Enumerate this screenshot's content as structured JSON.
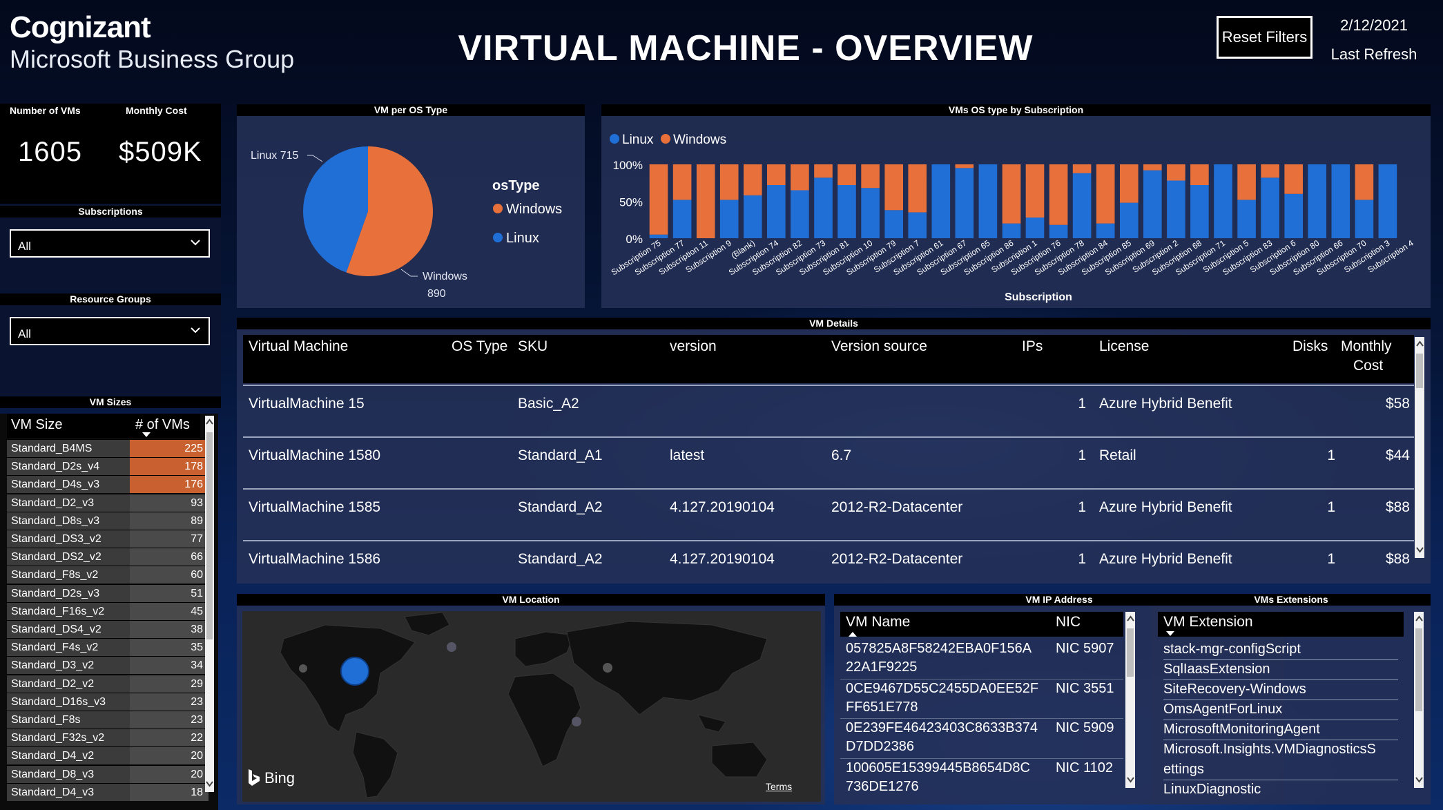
{
  "brand": {
    "company": "Cognizant",
    "group": "Microsoft Business Group"
  },
  "header": {
    "title": "VIRTUAL MACHINE - OVERVIEW",
    "reset_label": "Reset Filters",
    "refresh_date": "2/12/2021",
    "refresh_label": "Last Refresh"
  },
  "kpis": {
    "vms_label": "Number of VMs",
    "vms_value": "1605",
    "cost_label": "Monthly Cost",
    "cost_value": "$509K"
  },
  "filters": {
    "subscriptions_label": "Subscriptions",
    "subscriptions_value": "All",
    "rg_label": "Resource Groups",
    "rg_value": "All"
  },
  "vm_sizes": {
    "title": "VM Sizes",
    "col_size": "VM Size",
    "col_count": "# of VMs",
    "rows": [
      {
        "name": "Standard_B4MS",
        "count": "225",
        "hl": true
      },
      {
        "name": "Standard_D2s_v4",
        "count": "178",
        "hl": true
      },
      {
        "name": "Standard_D4s_v3",
        "count": "176",
        "hl": true
      },
      {
        "name": "Standard_D2_v3",
        "count": "93",
        "hl": false
      },
      {
        "name": "Standard_D8s_v3",
        "count": "89",
        "hl": false
      },
      {
        "name": "Standard_DS3_v2",
        "count": "77",
        "hl": false
      },
      {
        "name": "Standard_DS2_v2",
        "count": "66",
        "hl": false
      },
      {
        "name": "Standard_F8s_v2",
        "count": "60",
        "hl": false
      },
      {
        "name": "Standard_D2s_v3",
        "count": "51",
        "hl": false
      },
      {
        "name": "Standard_F16s_v2",
        "count": "45",
        "hl": false
      },
      {
        "name": "Standard_DS4_v2",
        "count": "38",
        "hl": false
      },
      {
        "name": "Standard_F4s_v2",
        "count": "35",
        "hl": false
      },
      {
        "name": "Standard_D3_v2",
        "count": "34",
        "hl": false
      },
      {
        "name": "Standard_D2_v2",
        "count": "29",
        "hl": false
      },
      {
        "name": "Standard_D16s_v3",
        "count": "23",
        "hl": false
      },
      {
        "name": "Standard_F8s",
        "count": "23",
        "hl": false
      },
      {
        "name": "Standard_F32s_v2",
        "count": "22",
        "hl": false
      },
      {
        "name": "Standard_D4_v2",
        "count": "20",
        "hl": false
      },
      {
        "name": "Standard_D8_v3",
        "count": "20",
        "hl": false
      },
      {
        "name": "Standard_D4_v3",
        "count": "18",
        "hl": false
      }
    ]
  },
  "colors": {
    "linux": "#1f6fd6",
    "windows": "#e8703a",
    "accent_row": "#c8612f"
  },
  "chart_data": [
    {
      "type": "pie",
      "title": "VM per OS Type",
      "legend_title": "osType",
      "labels": [
        "Windows",
        "Linux"
      ],
      "values": [
        890,
        715
      ],
      "slice_labels": [
        "Windows",
        "890",
        "Linux 715"
      ],
      "legend": "right"
    },
    {
      "type": "bar",
      "stacked": "100%",
      "title": "VMs OS type by Subscription",
      "xlabel": "Subscription",
      "y_ticks": [
        "100%",
        "50%",
        "0%"
      ],
      "ylim": [
        0,
        100
      ],
      "legend": "top-left",
      "categories": [
        "Subscription 75",
        "Subscription 77",
        "Subscription 11",
        "Subscription 9",
        "(Blank)",
        "Subscription 74",
        "Subscription 82",
        "Subscription 73",
        "Subscription 81",
        "Subscription 10",
        "Subscription 79",
        "Subscription 7",
        "Subscription 61",
        "Subscription 67",
        "Subscription 65",
        "Subscription 86",
        "Subscription 1",
        "Subscription 76",
        "Subscription 78",
        "Subscription 84",
        "Subscription 85",
        "Subscription 69",
        "Subscription 2",
        "Subscription 68",
        "Subscription 71",
        "Subscription 5",
        "Subscription 83",
        "Subscription 6",
        "Subscription 80",
        "Subscription 66",
        "Subscription 70",
        "Subscription 3",
        "Subscription 4"
      ],
      "series": [
        {
          "name": "Linux",
          "values": [
            5,
            52,
            0,
            52,
            58,
            72,
            65,
            82,
            72,
            68,
            38,
            35,
            100,
            95,
            100,
            20,
            28,
            18,
            88,
            20,
            48,
            92,
            78,
            72,
            100,
            52,
            82,
            60,
            100,
            100,
            52,
            100,
            0
          ]
        },
        {
          "name": "Windows",
          "values": [
            95,
            48,
            100,
            48,
            42,
            28,
            35,
            18,
            28,
            32,
            62,
            65,
            0,
            5,
            0,
            80,
            72,
            82,
            12,
            80,
            52,
            8,
            22,
            28,
            0,
            48,
            18,
            40,
            0,
            0,
            48,
            0,
            0
          ]
        }
      ]
    }
  ],
  "vm_details": {
    "title": "VM Details",
    "columns": [
      "Virtual Machine",
      "OS Type",
      "SKU",
      "version",
      "Version source",
      "IPs",
      "License",
      "Disks",
      "Monthly",
      "Cost"
    ],
    "rows": [
      {
        "vm": "VirtualMachine 15",
        "os": "",
        "sku": "Basic_A2",
        "version": "",
        "source": "",
        "ips": "1",
        "license": "Azure Hybrid Benefit",
        "disks": "",
        "cost": "$58"
      },
      {
        "vm": "VirtualMachine 1580",
        "os": "",
        "sku": "Standard_A1",
        "version": "latest",
        "source": "6.7",
        "ips": "1",
        "license": "Retail",
        "disks": "1",
        "cost": "$44"
      },
      {
        "vm": "VirtualMachine 1585",
        "os": "",
        "sku": "Standard_A2",
        "version": "4.127.20190104",
        "source": "2012-R2-Datacenter",
        "ips": "1",
        "license": "Azure Hybrid Benefit",
        "disks": "1",
        "cost": "$88"
      },
      {
        "vm": "VirtualMachine 1586",
        "os": "",
        "sku": "Standard_A2",
        "version": "4.127.20190104",
        "source": "2012-R2-Datacenter",
        "ips": "1",
        "license": "Azure Hybrid Benefit",
        "disks": "1",
        "cost": "$88"
      }
    ]
  },
  "vm_location": {
    "title": "VM Location",
    "map_logo": "Bing",
    "terms": "Terms"
  },
  "vm_ip": {
    "title": "VM IP Address",
    "col_name": "VM Name",
    "col_nic": "NIC",
    "rows": [
      {
        "l1": "057825A8F58242EBA0F156A",
        "l2": "22A1F9225",
        "nic": "NIC 5907"
      },
      {
        "l1": "0CE9467D55C2455DA0EE52F",
        "l2": "FF651E778",
        "nic": "NIC 3551"
      },
      {
        "l1": "0E239FE46423403C8633B374",
        "l2": "D7DD2386",
        "nic": "NIC 5909"
      },
      {
        "l1": "100605E15399445B8654D8C",
        "l2": "736DE1276",
        "nic": "NIC 1102"
      }
    ]
  },
  "vm_ext": {
    "title": "VMs Extensions",
    "col": "VM Extension",
    "items": [
      "stack-mgr-configScript",
      "SqlIaasExtension",
      "SiteRecovery-Windows",
      "OmsAgentForLinux",
      "MicrosoftMonitoringAgent",
      "Microsoft.Insights.VMDiagnosticsS",
      "ettings",
      "LinuxDiagnostic"
    ]
  }
}
